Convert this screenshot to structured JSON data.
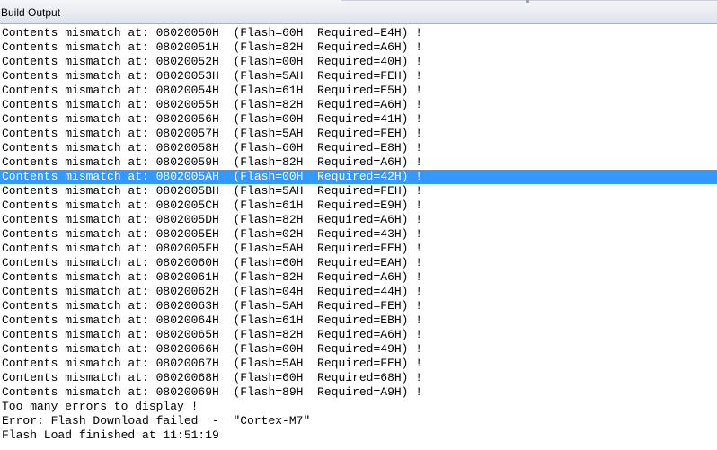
{
  "panel": {
    "title": "Build Output"
  },
  "output": {
    "selected_index": 10,
    "lines": [
      "Contents mismatch at: 08020050H  (Flash=60H  Required=E4H) !",
      "Contents mismatch at: 08020051H  (Flash=82H  Required=A6H) !",
      "Contents mismatch at: 08020052H  (Flash=00H  Required=40H) !",
      "Contents mismatch at: 08020053H  (Flash=5AH  Required=FEH) !",
      "Contents mismatch at: 08020054H  (Flash=61H  Required=E5H) !",
      "Contents mismatch at: 08020055H  (Flash=82H  Required=A6H) !",
      "Contents mismatch at: 08020056H  (Flash=00H  Required=41H) !",
      "Contents mismatch at: 08020057H  (Flash=5AH  Required=FEH) !",
      "Contents mismatch at: 08020058H  (Flash=60H  Required=E8H) !",
      "Contents mismatch at: 08020059H  (Flash=82H  Required=A6H) !",
      "Contents mismatch at: 0802005AH  (Flash=00H  Required=42H) !",
      "Contents mismatch at: 0802005BH  (Flash=5AH  Required=FEH) !",
      "Contents mismatch at: 0802005CH  (Flash=61H  Required=E9H) !",
      "Contents mismatch at: 0802005DH  (Flash=82H  Required=A6H) !",
      "Contents mismatch at: 0802005EH  (Flash=02H  Required=43H) !",
      "Contents mismatch at: 0802005FH  (Flash=5AH  Required=FEH) !",
      "Contents mismatch at: 08020060H  (Flash=60H  Required=EAH) !",
      "Contents mismatch at: 08020061H  (Flash=82H  Required=A6H) !",
      "Contents mismatch at: 08020062H  (Flash=04H  Required=44H) !",
      "Contents mismatch at: 08020063H  (Flash=5AH  Required=FEH) !",
      "Contents mismatch at: 08020064H  (Flash=61H  Required=EBH) !",
      "Contents mismatch at: 08020065H  (Flash=82H  Required=A6H) !",
      "Contents mismatch at: 08020066H  (Flash=00H  Required=49H) !",
      "Contents mismatch at: 08020067H  (Flash=5AH  Required=FEH) !",
      "Contents mismatch at: 08020068H  (Flash=60H  Required=68H) !",
      "Contents mismatch at: 08020069H  (Flash=89H  Required=A9H) !",
      "Too many errors to display !",
      "Error: Flash Download failed  -  \"Cortex-M7\"",
      "Flash Load finished at 11:51:19"
    ]
  },
  "colors": {
    "selection_background": "#3399ff",
    "selection_text": "#ffffff",
    "text": "#000000",
    "background": "#ffffff"
  }
}
